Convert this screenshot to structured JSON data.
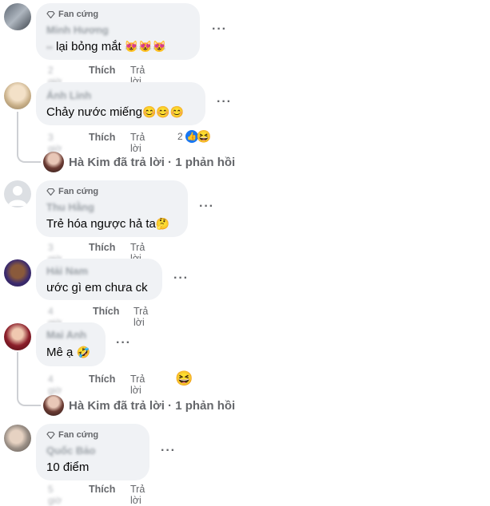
{
  "labels": {
    "fan_badge": "Fan cứng",
    "like": "Thích",
    "reply": "Trả lời",
    "more": "···",
    "reply_summary": "Hà Kim đã trả lời · 1 phản hồi"
  },
  "comments": [
    {
      "name": "Minh Hương",
      "badge": true,
      "text": "lại bỏng mắt",
      "emoji": "😻😻😻",
      "prefix": "▪▪"
    },
    {
      "name": "Ánh Linh",
      "badge": false,
      "text": "Chảy nước miếng",
      "emoji": "😊😊😊",
      "reaction_count": "2"
    },
    {
      "name": "Thu Hằng",
      "badge": true,
      "text": "Trẻ hóa ngược hả ta",
      "emoji": "🤔"
    },
    {
      "name": "Hải Nam",
      "badge": false,
      "text": "ước gì em chưa ck",
      "emoji": ""
    },
    {
      "name": "Mai Anh",
      "badge": false,
      "text": "Mê ạ",
      "emoji": "🤣",
      "solo_emoji": "😆"
    },
    {
      "name": "Quốc Bảo",
      "badge": true,
      "text": "10 điểm",
      "emoji": ""
    }
  ],
  "timestamps": [
    "2 giờ",
    "3 giờ",
    "3 giờ",
    "4 giờ",
    "4 giờ",
    "5 giờ"
  ],
  "icons": {
    "diamond": "diamond-icon",
    "like_reaction": "like-reaction-icon",
    "haha_reaction": "haha-reaction-icon"
  },
  "colors": {
    "bubble": "#f0f2f5",
    "secondary_text": "#65676b",
    "like_blue": "#1877f2"
  }
}
